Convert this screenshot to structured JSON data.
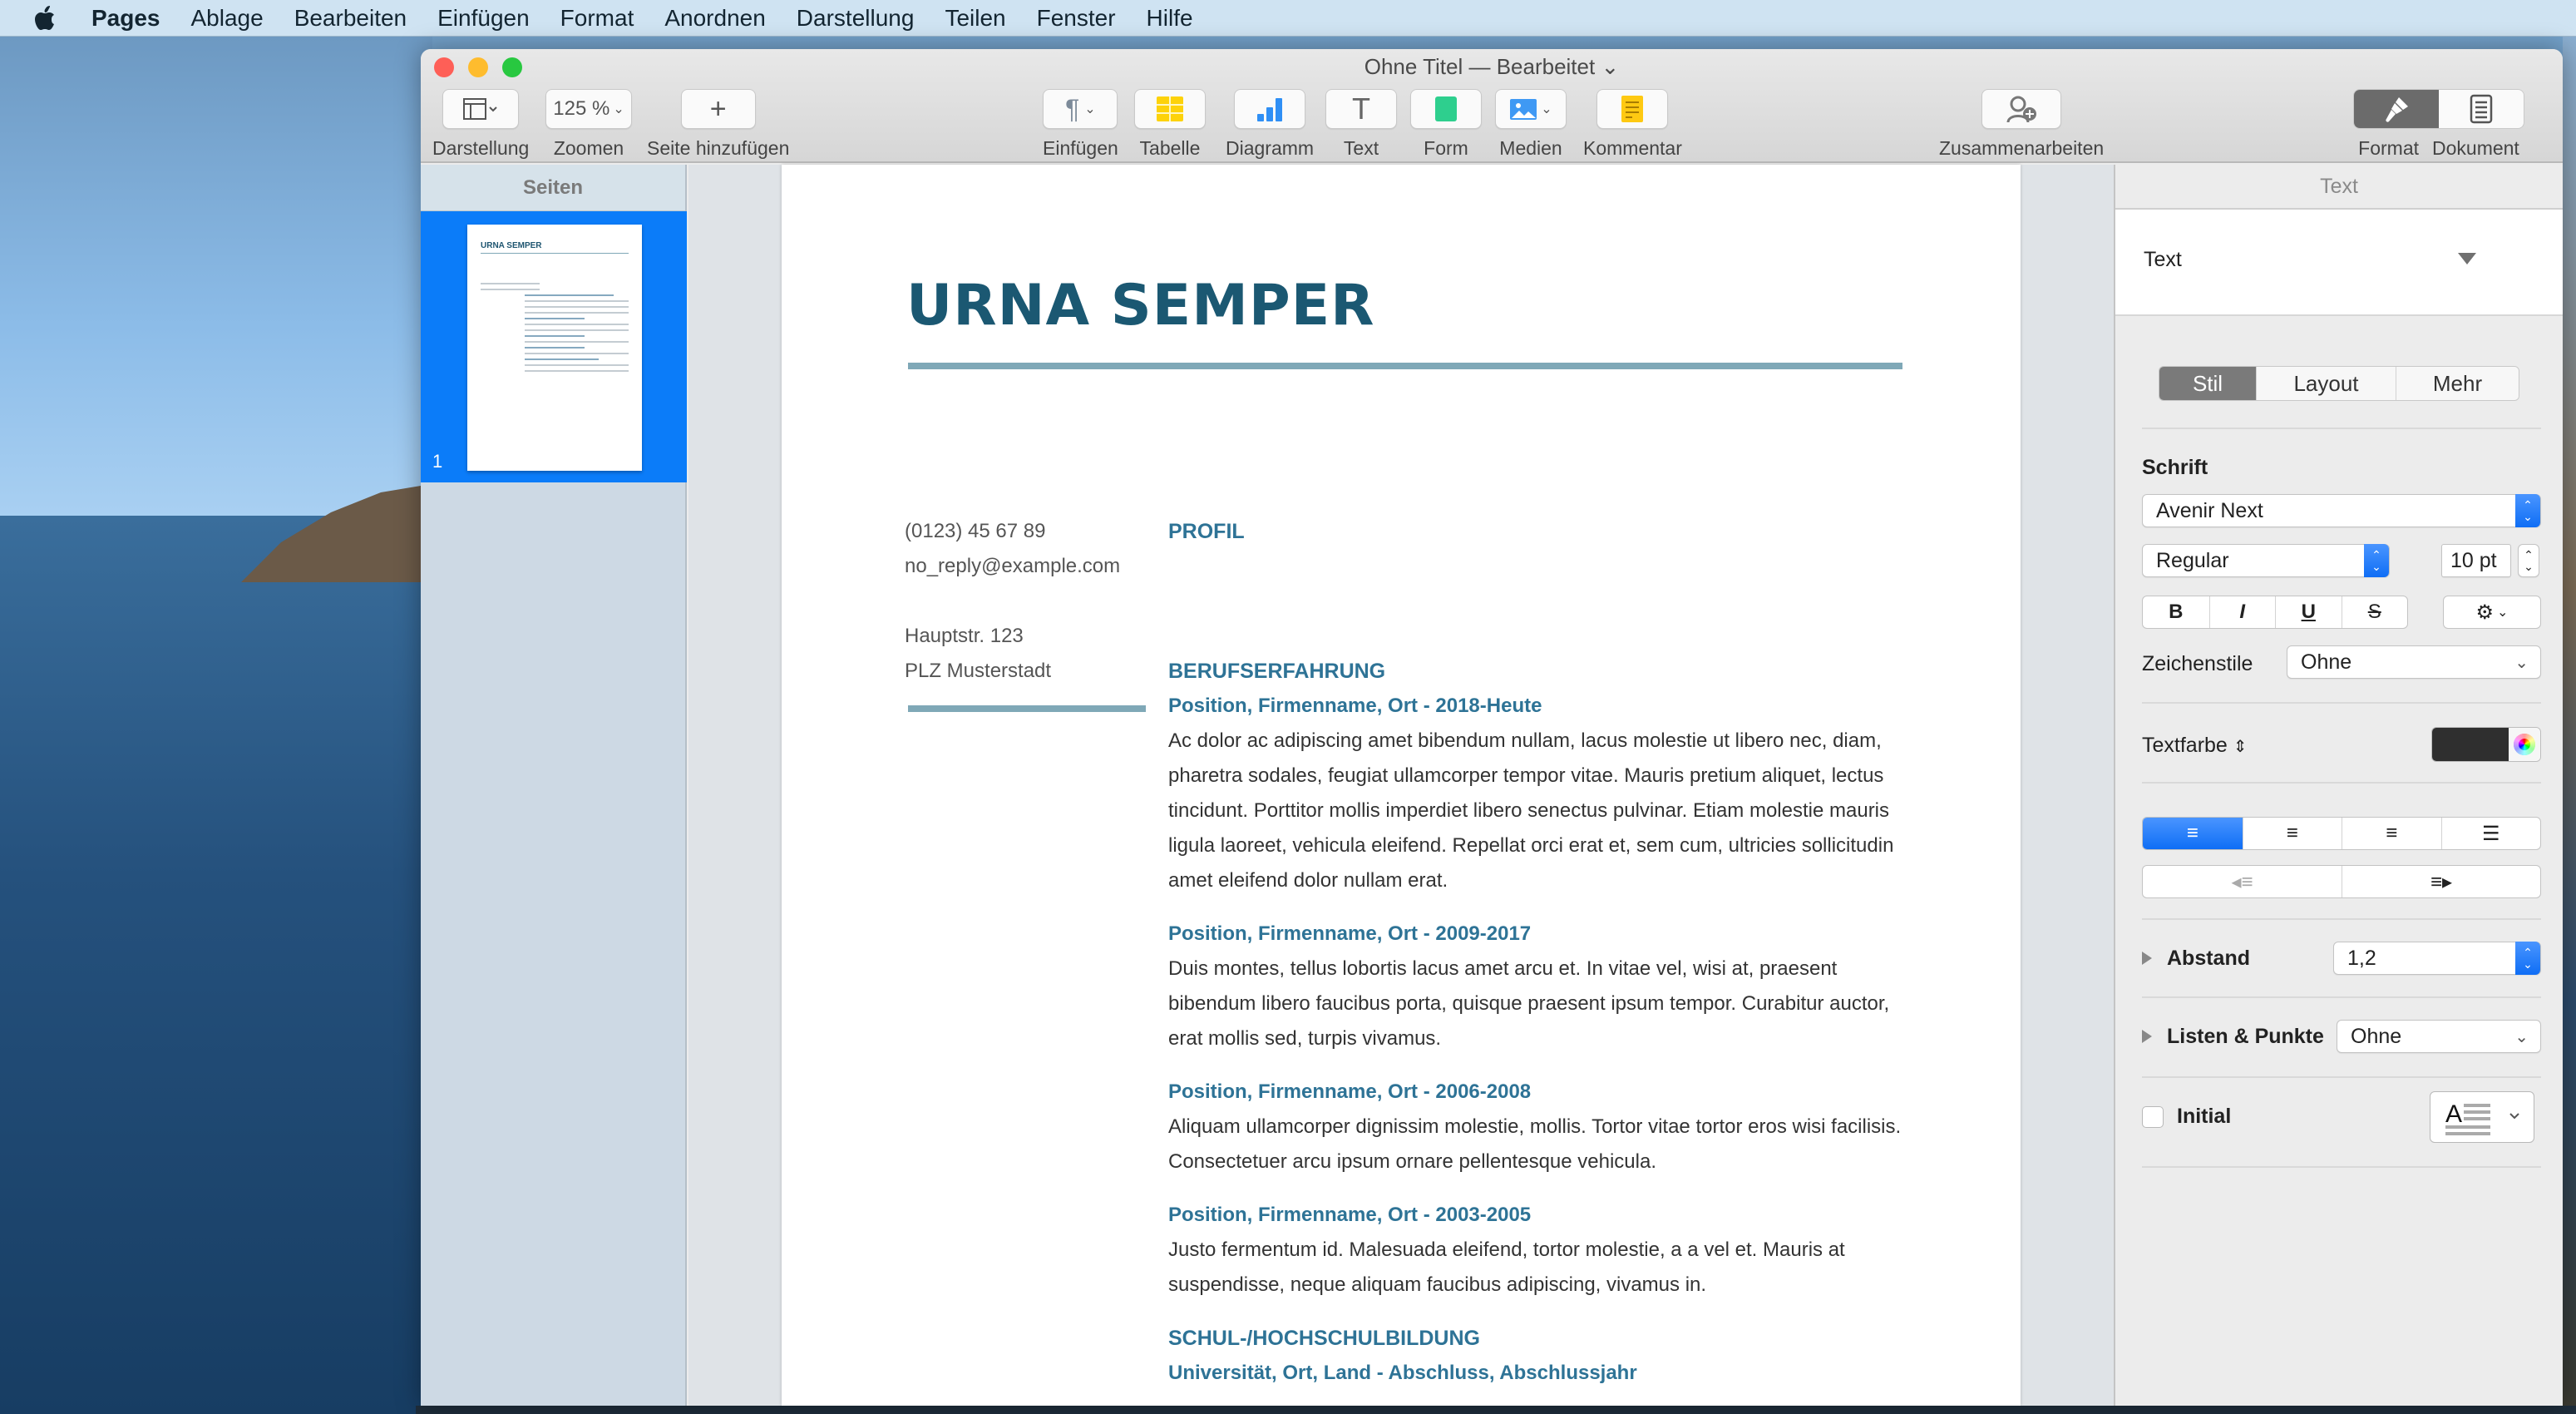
{
  "menubar": {
    "apple_icon": "apple-logo",
    "items": [
      "Pages",
      "Ablage",
      "Bearbeiten",
      "Einfügen",
      "Format",
      "Anordnen",
      "Darstellung",
      "Teilen",
      "Fenster",
      "Hilfe"
    ]
  },
  "window": {
    "title": "Ohne Titel — Bearbeitet",
    "title_chevron": "⌄"
  },
  "toolbar": {
    "darstellung": "Darstellung",
    "zoom_value": "125 %",
    "zoom_label": "Zoomen",
    "add_page": "Seite hinzufügen",
    "insert": "Einfügen",
    "table": "Tabelle",
    "chart": "Diagramm",
    "text": "Text",
    "shape": "Form",
    "media": "Medien",
    "comment": "Kommentar",
    "collaborate": "Zusammenarbeiten",
    "format": "Format",
    "document": "Dokument"
  },
  "sidebar": {
    "header": "Seiten",
    "pages": [
      {
        "number": "1",
        "thumb_title": "URNA SEMPER",
        "selected": true
      }
    ]
  },
  "document": {
    "name": "URNA SEMPER",
    "contact": {
      "phone": "(0123) 45 67 89",
      "email": "no_reply@example.com",
      "street": "Hauptstr. 123",
      "city": "PLZ Musterstadt"
    },
    "profile_heading": "PROFIL",
    "experience_heading": "BERUFSERFAHRUNG",
    "positions": [
      {
        "title": "Position, Firmenname, Ort - 2018-Heute",
        "body": "Ac dolor ac adipiscing amet bibendum nullam, lacus molestie ut libero nec, diam, pharetra sodales, feugiat ullamcorper tempor vitae. Mauris pretium aliquet, lectus tincidunt. Porttitor mollis imperdiet libero senectus pulvinar. Etiam molestie mauris ligula laoreet, vehicula eleifend. Repellat orci erat et, sem cum, ultricies sollicitudin amet eleifend dolor nullam erat."
      },
      {
        "title": "Position, Firmenname, Ort - 2009-2017",
        "body": "Duis montes, tellus lobortis lacus amet arcu et. In vitae vel, wisi at, praesent bibendum libero faucibus porta, quisque praesent ipsum tempor. Curabitur auctor, erat mollis sed, turpis vivamus."
      },
      {
        "title": "Position, Firmenname, Ort - 2006-2008",
        "body": "Aliquam ullamcorper dignissim molestie, mollis. Tortor vitae tortor eros wisi facilisis. Consectetuer arcu ipsum ornare pellentesque vehicula."
      },
      {
        "title": "Position, Firmenname, Ort - 2003-2005",
        "body": "Justo fermentum id. Malesuada eleifend, tortor molestie, a a vel et. Mauris at suspendisse, neque aliquam faucibus adipiscing, vivamus in."
      }
    ],
    "education_heading": "SCHUL-/HOCHSCHULBILDUNG",
    "education_entry": "Universität, Ort, Land - Abschluss, Abschlussjahr",
    "colors": {
      "heading": "#1b5872",
      "accent": "#2e7396",
      "rule": "#7fa8b7"
    }
  },
  "inspector": {
    "header": "Text",
    "paragraph_style": "Text",
    "tabs": [
      "Stil",
      "Layout",
      "Mehr"
    ],
    "active_tab": "Stil",
    "font_section": "Schrift",
    "font_family": "Avenir Next",
    "font_typeface": "Regular",
    "font_size": "10 pt",
    "style_buttons": [
      "B",
      "I",
      "U",
      "S"
    ],
    "char_styles_label": "Zeichenstile",
    "char_styles_value": "Ohne",
    "text_color_label": "Textfarbe",
    "text_color": "#2f2f2f",
    "alignment_active": "left",
    "spacing_label": "Abstand",
    "spacing_value": "1,2",
    "lists_label": "Listen & Punkte",
    "lists_value": "Ohne",
    "dropcap_label": "Initial",
    "dropcap_checked": false
  }
}
